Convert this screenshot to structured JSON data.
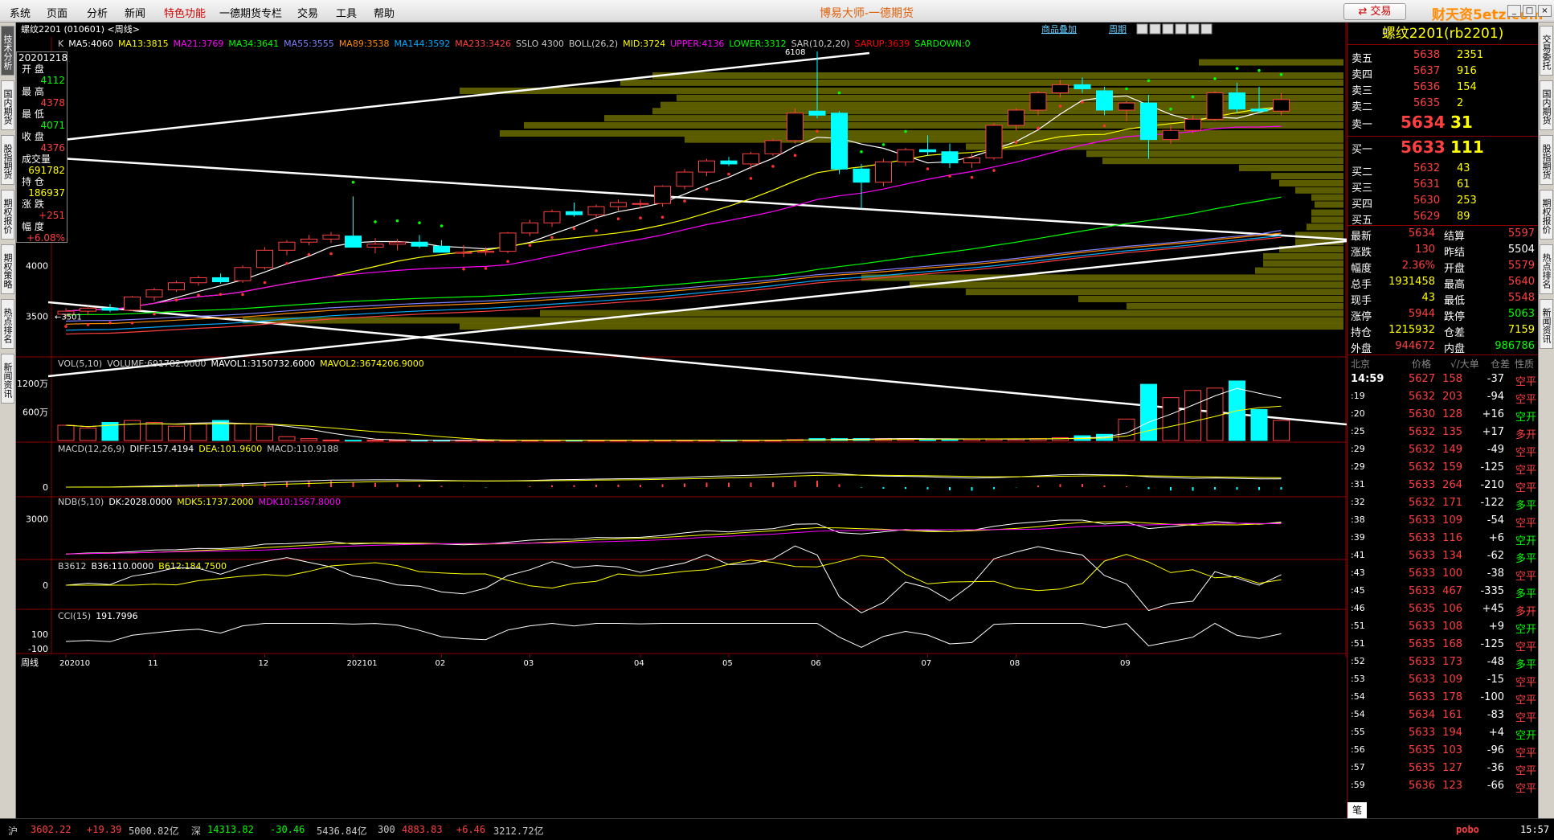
{
  "menu": [
    "系统",
    "页面",
    "分析",
    "新闻",
    "特色功能",
    "一德期货专栏",
    "交易",
    "工具",
    "帮助"
  ],
  "app_title": "博易大师-一德期货",
  "trade_button": "交易",
  "watermark": "财天资5etz.com",
  "left_tabs": [
    "技术分析",
    "国内期货",
    "股指期货",
    "期权报价",
    "期权策略",
    "热点排名",
    "新闻资讯"
  ],
  "right_tabs": [
    "交易委托",
    "国内期货",
    "股指期货",
    "期权报价",
    "热点排名",
    "新闻资讯"
  ],
  "chart_header": {
    "symbol": "螺纹2201 (010601) <周线>",
    "add_product": "商品叠加",
    "period": "周期"
  },
  "ma_line": [
    {
      "t": "K",
      "c": "#cccccc"
    },
    {
      "t": "MA5:4060",
      "c": "#ffffff"
    },
    {
      "t": "MA13:3815",
      "c": "#ffff00"
    },
    {
      "t": "MA21:3769",
      "c": "#ff00ff"
    },
    {
      "t": "MA34:3641",
      "c": "#00ff00"
    },
    {
      "t": "MA55:3555",
      "c": "#8080ff"
    },
    {
      "t": "MA89:3538",
      "c": "#ff8c00"
    },
    {
      "t": "MA144:3592",
      "c": "#00aaff"
    },
    {
      "t": "MA233:3426",
      "c": "#ff4040"
    },
    {
      "t": "SSLO 4300",
      "c": "#cccccc"
    },
    {
      "t": "BOLL(26,2)",
      "c": "#cccccc"
    },
    {
      "t": "MID:3724",
      "c": "#ffff00"
    },
    {
      "t": "UPPER:4136",
      "c": "#ff00ff"
    },
    {
      "t": "LOWER:3312",
      "c": "#00ff00"
    },
    {
      "t": "SAR(10,2,20)",
      "c": "#cccccc"
    },
    {
      "t": "SARUP:3639",
      "c": "#ff0000"
    },
    {
      "t": "SARDOWN:0",
      "c": "#00ff00"
    }
  ],
  "infobox": {
    "date": "20201218",
    "rows": [
      [
        "开 盘",
        "4112",
        "#00ff00"
      ],
      [
        "最 高",
        "4378",
        "#ff4040"
      ],
      [
        "最 低",
        "4071",
        "#00ff00"
      ],
      [
        "收 盘",
        "4376",
        "#ff4040"
      ],
      [
        "成交量",
        "691782",
        "#ffff00"
      ],
      [
        "持 仓",
        "186937",
        "#ffff00"
      ],
      [
        "涨 跌",
        "+251",
        "#ff4040"
      ],
      [
        "幅 度",
        "+6.08%",
        "#ff4040"
      ]
    ]
  },
  "price_ticks": [
    "4500",
    "4000",
    "3500"
  ],
  "price_ticks_v": [
    4500,
    4000,
    3500
  ],
  "high_label": "6108",
  "low_label": "3501",
  "vol": {
    "header": [
      {
        "t": "VOL(5,10)",
        "c": "#cccccc"
      },
      {
        "t": "VOLUME:691782.0000",
        "c": "#cccccc"
      },
      {
        "t": "MAVOL1:3150732.6000",
        "c": "#ffffff"
      },
      {
        "t": "MAVOL2:3674206.9000",
        "c": "#ffff00"
      }
    ],
    "ticks": [
      "1200万",
      "600万"
    ]
  },
  "macd": {
    "header": [
      {
        "t": "MACD(12,26,9)",
        "c": "#cccccc"
      },
      {
        "t": "DIFF:157.4194",
        "c": "#ffffff"
      },
      {
        "t": "DEA:101.9600",
        "c": "#ffff00"
      },
      {
        "t": "MACD:110.9188",
        "c": "#cccccc"
      }
    ],
    "ticks": [
      "0"
    ]
  },
  "ndb": {
    "header": [
      {
        "t": "NDB(5,10)",
        "c": "#cccccc"
      },
      {
        "t": "DK:2028.0000",
        "c": "#ffffff"
      },
      {
        "t": "MDK5:1737.2000",
        "c": "#ffff00"
      },
      {
        "t": "MDK10:1567.8000",
        "c": "#ff00ff"
      }
    ],
    "ticks": [
      "3000"
    ]
  },
  "b36": {
    "header": [
      {
        "t": "B3612",
        "c": "#cccccc"
      },
      {
        "t": "B36:110.0000",
        "c": "#ffffff"
      },
      {
        "t": "B612:184.7500",
        "c": "#ffff00"
      }
    ],
    "ticks": [
      "0"
    ]
  },
  "cci": {
    "header": [
      {
        "t": "CCI(15)",
        "c": "#cccccc"
      },
      {
        "t": "191.7996",
        "c": "#ffffff"
      }
    ],
    "ticks": [
      "100",
      "-100"
    ]
  },
  "xaxis": {
    "label": "周线",
    "months": [
      "202010",
      "11",
      "12",
      "202101",
      "02",
      "03",
      "04",
      "05",
      "06",
      "07",
      "08",
      "09"
    ]
  },
  "chart_data": {
    "type": "candlestick",
    "period": "weekly",
    "symbol": "rb2201",
    "candles": [
      [
        3520,
        3580,
        3480,
        3550
      ],
      [
        3550,
        3600,
        3510,
        3580
      ],
      [
        3580,
        3620,
        3540,
        3560
      ],
      [
        3560,
        3700,
        3550,
        3690
      ],
      [
        3690,
        3780,
        3650,
        3760
      ],
      [
        3760,
        3850,
        3740,
        3830
      ],
      [
        3830,
        3900,
        3800,
        3880
      ],
      [
        3880,
        3920,
        3820,
        3840
      ],
      [
        3850,
        4000,
        3830,
        3980
      ],
      [
        3980,
        4180,
        3960,
        4150
      ],
      [
        4150,
        4250,
        4100,
        4230
      ],
      [
        4230,
        4300,
        4200,
        4260
      ],
      [
        4260,
        4330,
        4220,
        4300
      ],
      [
        4290,
        4680,
        4230,
        4180
      ],
      [
        4180,
        4270,
        4120,
        4210
      ],
      [
        4210,
        4260,
        4150,
        4230
      ],
      [
        4230,
        4300,
        4170,
        4190
      ],
      [
        4190,
        4250,
        4140,
        4130
      ],
      [
        4120,
        4200,
        4080,
        4130
      ],
      [
        4130,
        4180,
        4100,
        4140
      ],
      [
        4140,
        4330,
        4120,
        4320
      ],
      [
        4320,
        4450,
        4290,
        4420
      ],
      [
        4420,
        4550,
        4380,
        4530
      ],
      [
        4530,
        4620,
        4480,
        4500
      ],
      [
        4500,
        4600,
        4470,
        4580
      ],
      [
        4580,
        4650,
        4540,
        4620
      ],
      [
        4610,
        4650,
        4560,
        4610
      ],
      [
        4610,
        4790,
        4580,
        4780
      ],
      [
        4780,
        4950,
        4750,
        4920
      ],
      [
        4920,
        5050,
        4880,
        5030
      ],
      [
        5030,
        5070,
        4980,
        5000
      ],
      [
        5000,
        5120,
        4950,
        5100
      ],
      [
        5100,
        5250,
        5080,
        5230
      ],
      [
        5230,
        5550,
        5200,
        5500
      ],
      [
        5520,
        6108,
        5450,
        5480
      ],
      [
        5500,
        5520,
        4900,
        4950
      ],
      [
        4950,
        5000,
        4560,
        4820
      ],
      [
        4820,
        5050,
        4780,
        5020
      ],
      [
        5020,
        5160,
        4980,
        5140
      ],
      [
        5140,
        5280,
        5080,
        5120
      ],
      [
        5120,
        5200,
        4960,
        5010
      ],
      [
        5010,
        5100,
        4960,
        5060
      ],
      [
        5060,
        5400,
        5040,
        5380
      ],
      [
        5380,
        5550,
        5330,
        5530
      ],
      [
        5530,
        5720,
        5480,
        5700
      ],
      [
        5700,
        5830,
        5650,
        5780
      ],
      [
        5780,
        5850,
        5700,
        5740
      ],
      [
        5720,
        5760,
        5480,
        5530
      ],
      [
        5530,
        5620,
        5420,
        5600
      ],
      [
        5600,
        5680,
        5050,
        5240
      ],
      [
        5240,
        5380,
        5200,
        5330
      ],
      [
        5330,
        5480,
        5300,
        5440
      ],
      [
        5440,
        5720,
        5420,
        5700
      ],
      [
        5700,
        5800,
        5500,
        5540
      ],
      [
        5540,
        5760,
        5500,
        5520
      ],
      [
        5520,
        5700,
        5480,
        5634
      ]
    ],
    "volume_wan": [
      320,
      260,
      380,
      420,
      380,
      300,
      350,
      420,
      350,
      300,
      80,
      40,
      10,
      5,
      5,
      5,
      5,
      5,
      5,
      5,
      5,
      5,
      5,
      5,
      5,
      5,
      5,
      5,
      5,
      5,
      5,
      5,
      5,
      20,
      40,
      40,
      40,
      40,
      40,
      30,
      30,
      30,
      30,
      30,
      40,
      60,
      100,
      130,
      450,
      1180,
      900,
      1050,
      1100,
      1250,
      650,
      420
    ]
  },
  "quote": {
    "title": "螺纹2201(rb2201)",
    "asks": [
      [
        "卖五",
        "5638",
        "2351"
      ],
      [
        "卖四",
        "5637",
        "916"
      ],
      [
        "卖三",
        "5636",
        "154"
      ],
      [
        "卖二",
        "5635",
        "2"
      ],
      [
        "卖一",
        "5634",
        "31"
      ]
    ],
    "bids": [
      [
        "买一",
        "5633",
        "111"
      ],
      [
        "买二",
        "5632",
        "43"
      ],
      [
        "买三",
        "5631",
        "61"
      ],
      [
        "买四",
        "5630",
        "253"
      ],
      [
        "买五",
        "5629",
        "89"
      ]
    ],
    "stats": [
      [
        "最新",
        "5634",
        "#ff4040",
        "结算",
        "5597",
        "#ff4040"
      ],
      [
        "涨跌",
        "130",
        "#ff4040",
        "昨结",
        "5504",
        "#ffffff"
      ],
      [
        "幅度",
        "2.36%",
        "#ff4040",
        "开盘",
        "5579",
        "#ff4040"
      ],
      [
        "总手",
        "1931458",
        "#ffff00",
        "最高",
        "5640",
        "#ff4040"
      ],
      [
        "现手",
        "43",
        "#ffff00",
        "最低",
        "5548",
        "#ff4040"
      ],
      [
        "涨停",
        "5944",
        "#ff4040",
        "跌停",
        "5063",
        "#00ff00"
      ],
      [
        "持仓",
        "1215932",
        "#ffff00",
        "仓差",
        "7159",
        "#ffff00"
      ],
      [
        "外盘",
        "944672",
        "#ff4040",
        "内盘",
        "986786",
        "#00ff00"
      ]
    ],
    "tick_header": [
      "北京",
      "价格",
      "√/大单",
      "仓差",
      "性质"
    ],
    "ticks": [
      [
        "14:59",
        "5627",
        "158",
        "-37",
        "空平"
      ],
      [
        ":19",
        "5632",
        "203",
        "-94",
        "空平"
      ],
      [
        ":20",
        "5630",
        "128",
        "+16",
        "空开"
      ],
      [
        ":25",
        "5632",
        "135",
        "+17",
        "多开"
      ],
      [
        ":29",
        "5632",
        "149",
        "-49",
        "空平"
      ],
      [
        ":29",
        "5632",
        "159",
        "-125",
        "空平"
      ],
      [
        ":31",
        "5633",
        "264",
        "-210",
        "空平"
      ],
      [
        ":32",
        "5632",
        "171",
        "-122",
        "多平"
      ],
      [
        ":38",
        "5633",
        "109",
        "-54",
        "空平"
      ],
      [
        ":39",
        "5633",
        "116",
        "+6",
        "空开"
      ],
      [
        ":41",
        "5633",
        "134",
        "-62",
        "多平"
      ],
      [
        ":43",
        "5633",
        "100",
        "-38",
        "空平"
      ],
      [
        ":45",
        "5633",
        "467",
        "-335",
        "多平"
      ],
      [
        ":46",
        "5635",
        "106",
        "+45",
        "多开"
      ],
      [
        ":51",
        "5633",
        "108",
        "+9",
        "空开"
      ],
      [
        ":51",
        "5635",
        "168",
        "-125",
        "空平"
      ],
      [
        ":52",
        "5633",
        "173",
        "-48",
        "多平"
      ],
      [
        ":53",
        "5633",
        "109",
        "-15",
        "空平"
      ],
      [
        ":54",
        "5633",
        "178",
        "-100",
        "空平"
      ],
      [
        ":54",
        "5634",
        "161",
        "-83",
        "空平"
      ],
      [
        ":55",
        "5633",
        "194",
        "+4",
        "空开"
      ],
      [
        ":56",
        "5635",
        "103",
        "-96",
        "空平"
      ],
      [
        ":57",
        "5635",
        "127",
        "-36",
        "空平"
      ],
      [
        ":59",
        "5636",
        "123",
        "-66",
        "空平"
      ]
    ],
    "footer_tab": "笔"
  },
  "status": {
    "items": [
      [
        "沪",
        "#cccccc"
      ],
      [
        "3602.22",
        "#ff4040"
      ],
      [
        "+19.39",
        "#ff4040"
      ],
      [
        "5000.82亿",
        "#cccccc"
      ],
      [
        "深",
        "#cccccc"
      ],
      [
        "14313.82",
        "#00ff00"
      ],
      [
        "-30.46",
        "#00ff00"
      ],
      [
        "5436.84亿",
        "#cccccc"
      ],
      [
        "300",
        "#cccccc"
      ],
      [
        "4883.83",
        "#ff4040"
      ],
      [
        "+6.46",
        "#ff4040"
      ],
      [
        "3212.72亿",
        "#cccccc"
      ]
    ],
    "brand": "pobo",
    "time": "15:57"
  }
}
